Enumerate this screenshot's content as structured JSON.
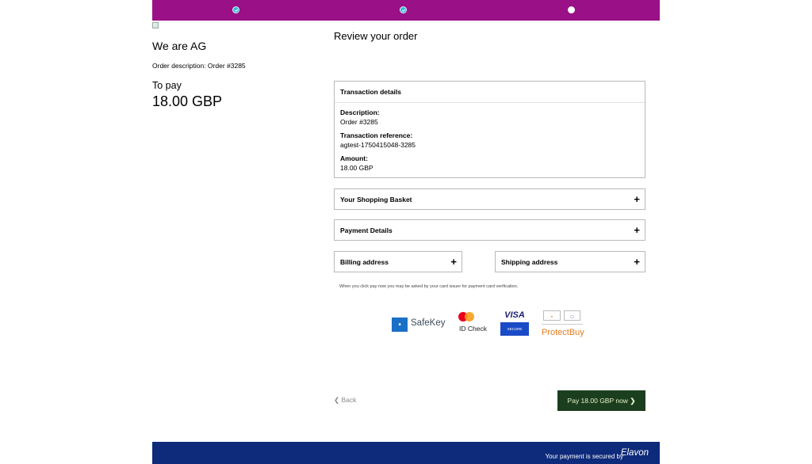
{
  "merchant": {
    "name": "We are AG",
    "order_description": "Order description: Order #3285",
    "to_pay_label": "To pay",
    "to_pay_amount": "18.00 GBP"
  },
  "steps": [
    {
      "state": "done"
    },
    {
      "state": "done"
    },
    {
      "state": "current"
    }
  ],
  "review_title": "Review your order",
  "transaction": {
    "heading": "Transaction details",
    "description_label": "Description:",
    "description_value": "Order #3285",
    "reference_label": "Transaction reference:",
    "reference_value": "agtest-1750415048-3285",
    "amount_label": "Amount:",
    "amount_value": "18.00 GBP"
  },
  "accordions": {
    "basket": "Your Shopping Basket",
    "payment": "Payment Details",
    "billing": "Billing address",
    "shipping": "Shipping address",
    "expand_glyph": "+"
  },
  "notice": "When you click pay now you may be asked by your card issuer for payment card verification.",
  "badges": {
    "safekey": "SafeKey",
    "idcheck": "ID Check",
    "visa": "VISA",
    "visa_secure": "SECURE",
    "protectbuy": "ProtectBuy"
  },
  "actions": {
    "back": "Back",
    "pay": "Pay 18.00 GBP now"
  },
  "footer": {
    "secured": "Your payment is secured by",
    "brand": "Elavon"
  },
  "colors": {
    "header": "#9a1086",
    "footer": "#0e2a7a",
    "pay_button": "#1b3e1e"
  }
}
